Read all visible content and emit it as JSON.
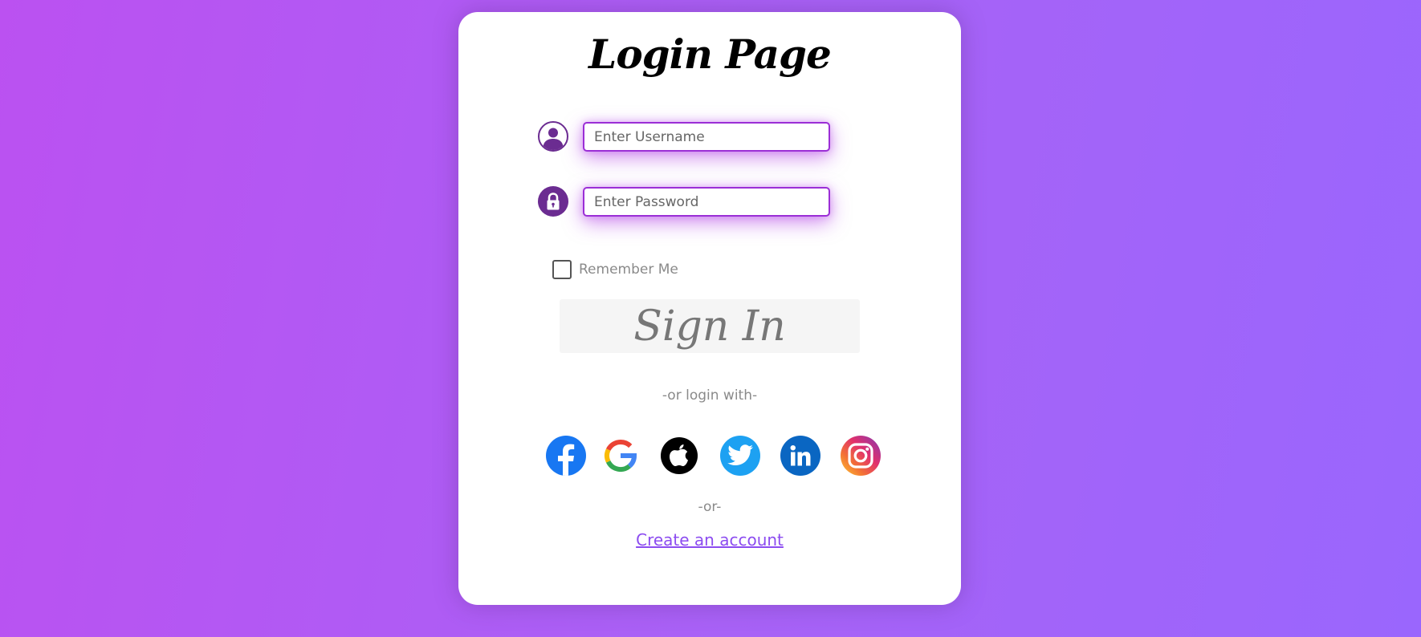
{
  "page": {
    "background_start": "#bb51f1",
    "background_end": "#9a66fd"
  },
  "login": {
    "title": "Login Page",
    "username": {
      "icon": "user-icon",
      "placeholder": "Enter Username",
      "value": ""
    },
    "password": {
      "icon": "lock-icon",
      "placeholder": "Enter Password",
      "value": ""
    },
    "remember_me": {
      "label": "Remember Me",
      "checked": false
    },
    "signin_label": "Sign In",
    "or_login_with": "-or login with-",
    "social_providers": [
      {
        "name": "facebook",
        "icon": "facebook-icon",
        "color": "#1877f2"
      },
      {
        "name": "google",
        "icon": "google-icon",
        "color": "#ffffff"
      },
      {
        "name": "apple",
        "icon": "apple-icon",
        "color": "#000000"
      },
      {
        "name": "twitter",
        "icon": "twitter-icon",
        "color": "#1da1f2"
      },
      {
        "name": "linkedin",
        "icon": "linkedin-icon",
        "color": "#0a66c2"
      },
      {
        "name": "instagram",
        "icon": "instagram-icon",
        "color": "#e1306c"
      }
    ],
    "or_text": "-or-",
    "create_account_label": "Create an account",
    "accent_color": "#9b2ed6",
    "link_color": "#8c4cf0"
  }
}
